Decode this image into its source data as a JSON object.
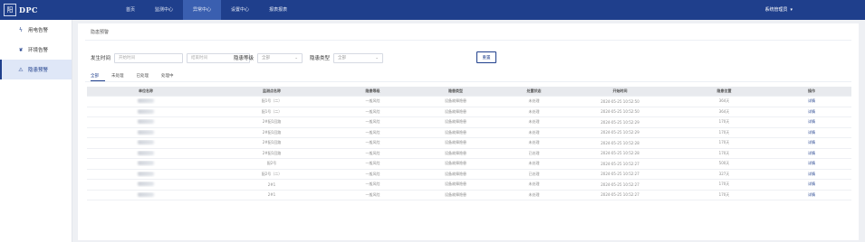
{
  "header": {
    "logo_glyph": "阳",
    "logo_text": "DPC",
    "nav": [
      "首页",
      "监测中心",
      "异常中心",
      "设置中心",
      "报表报表"
    ],
    "active_nav": 2,
    "user": "系统管理员"
  },
  "sidebar": {
    "items": [
      {
        "label": "用电告警",
        "icon": "bolt-icon"
      },
      {
        "label": "环境告警",
        "icon": "leaf-icon"
      },
      {
        "label": "隐患预警",
        "icon": "warning-icon"
      }
    ],
    "active_index": 2
  },
  "main": {
    "breadcrumb": "隐患预警",
    "filters": {
      "time_label": "发生时间",
      "start_placeholder": "开始时间",
      "end_placeholder": "结束时间",
      "level_label": "隐患等级",
      "level_value": "全部",
      "type_label": "隐患类型",
      "type_value": "全部",
      "reset": "重置"
    },
    "tabs": [
      "全部",
      "未处理",
      "已处理",
      "处理中"
    ],
    "active_tab": 0,
    "table": {
      "headers": [
        "单位名称",
        "监测点名称",
        "隐患等级",
        "隐患类型",
        "处置状态",
        "开始时间",
        "隐患位置",
        "操作"
      ],
      "rows": [
        [
          "",
          "配1号（二）",
          "一般风险",
          "设备故障隐患",
          "未处理",
          "2024-05-25 10:52:50",
          "364天",
          "详情"
        ],
        [
          "",
          "配1号（二）",
          "一般风险",
          "设备故障隐患",
          "未处理",
          "2024-05-25 10:52:50",
          "364天",
          "详情"
        ],
        [
          "",
          "2#配1回路",
          "一般风险",
          "设备故障隐患",
          "未处理",
          "2024-05-25 10:52:29",
          "170天",
          "详情"
        ],
        [
          "",
          "2#配1回路",
          "一般风险",
          "设备故障隐患",
          "未处理",
          "2024-05-25 10:52:29",
          "170天",
          "详情"
        ],
        [
          "",
          "2#配1回路",
          "一般风险",
          "设备故障隐患",
          "未处理",
          "2024-05-25 10:52:28",
          "170天",
          "详情"
        ],
        [
          "",
          "2#配1回路",
          "一般风险",
          "设备故障隐患",
          "已处理",
          "2024-05-25 10:52:28",
          "170天",
          "详情"
        ],
        [
          "",
          "配2号",
          "一般风险",
          "设备故障隐患",
          "未处理",
          "2024-05-25 10:52:27",
          "500天",
          "详情"
        ],
        [
          "",
          "配2号（二）",
          "一般风险",
          "设备故障隐患",
          "已处理",
          "2024-05-25 10:52:27",
          "327天",
          "详情"
        ],
        [
          "",
          "2#1",
          "一般风险",
          "设备故障隐患",
          "未处理",
          "2024-05-25 10:52:27",
          "170天",
          "详情"
        ],
        [
          "",
          "2#1",
          "一般风险",
          "设备故障隐患",
          "未处理",
          "2024-05-25 10:52:27",
          "170天",
          "详情"
        ]
      ]
    }
  }
}
